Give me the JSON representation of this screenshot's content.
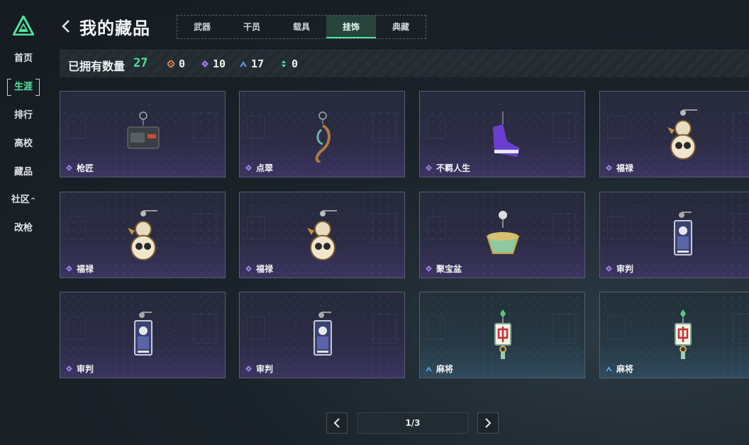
{
  "sidebar": {
    "items": [
      {
        "label": "首页"
      },
      {
        "label": "生涯",
        "active": true
      },
      {
        "label": "排行"
      },
      {
        "label": "高校"
      },
      {
        "label": "藏品"
      },
      {
        "label": "社区",
        "caret": "^"
      },
      {
        "label": "改枪"
      }
    ]
  },
  "header": {
    "title": "我的藏品",
    "tabs": [
      "武器",
      "干员",
      "载具",
      "挂饰",
      "典藏"
    ],
    "active_tab": "挂饰"
  },
  "summary": {
    "label": "已拥有数量",
    "total": "27",
    "rarity_counts": [
      {
        "icon": "orange-diamond-icon",
        "color": "#e0894a",
        "count": "0"
      },
      {
        "icon": "purple-diamond-icon",
        "color": "#9a7ce0",
        "count": "10"
      },
      {
        "icon": "blue-triangle-icon",
        "color": "#5a9ad8",
        "count": "17"
      },
      {
        "icon": "green-arrows-icon",
        "color": "#4ee39a",
        "count": "0"
      }
    ]
  },
  "collection": {
    "items": [
      {
        "name": "枪匠",
        "rarity": "purple",
        "art": "gunsmith-box-charm-icon"
      },
      {
        "name": "点翠",
        "rarity": "purple",
        "art": "phoenix-charm-icon"
      },
      {
        "name": "不羁人生",
        "rarity": "purple",
        "art": "sneaker-charm-icon"
      },
      {
        "name": "福禄",
        "rarity": "purple",
        "art": "gourd-charm-icon"
      },
      {
        "name": "福禄",
        "rarity": "purple",
        "art": "gourd-charm-icon"
      },
      {
        "name": "福禄",
        "rarity": "purple",
        "art": "gourd-charm-icon"
      },
      {
        "name": "聚宝盆",
        "rarity": "purple",
        "art": "treasure-bowl-charm-icon"
      },
      {
        "name": "审判",
        "rarity": "purple",
        "art": "judge-card-charm-icon"
      },
      {
        "name": "审判",
        "rarity": "purple",
        "art": "judge-card-charm-icon"
      },
      {
        "name": "审判",
        "rarity": "purple",
        "art": "judge-card-charm-icon"
      },
      {
        "name": "麻将",
        "rarity": "blue",
        "art": "mahjong-tile-charm-icon"
      },
      {
        "name": "麻将",
        "rarity": "blue",
        "art": "mahjong-tile-charm-icon"
      }
    ]
  },
  "pagination": {
    "page_text": "1/3",
    "prev_icon": "chevron-left-icon",
    "next_icon": "chevron-right-icon"
  },
  "colors": {
    "accent_green": "#4ee39a",
    "purple_rarity": "#9a7ce0",
    "blue_rarity": "#5a9ad8"
  }
}
